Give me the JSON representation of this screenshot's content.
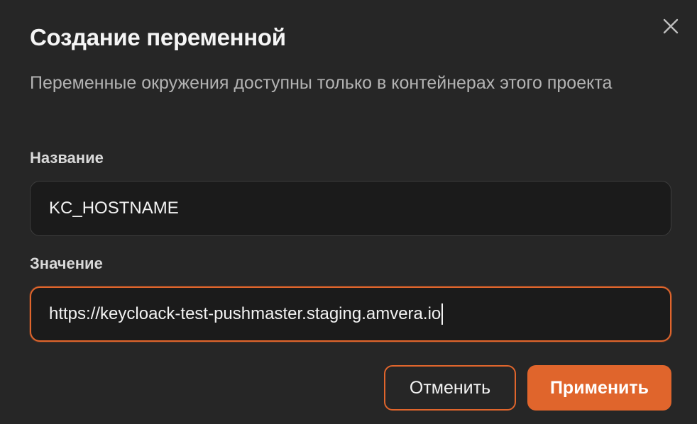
{
  "dialog": {
    "title": "Создание переменной",
    "subtitle": "Переменные окружения доступны только в контейнерах этого проекта",
    "close_icon": "close-icon"
  },
  "fields": {
    "name": {
      "label": "Название",
      "value": "KC_HOSTNAME"
    },
    "value": {
      "label": "Значение",
      "value": "https://keycloack-test-pushmaster.staging.amvera.io",
      "focused": true
    }
  },
  "actions": {
    "cancel_label": "Отменить",
    "apply_label": "Применить"
  },
  "colors": {
    "background": "#262626",
    "accent": "#e0652c",
    "input_bg": "#1b1b1b"
  }
}
